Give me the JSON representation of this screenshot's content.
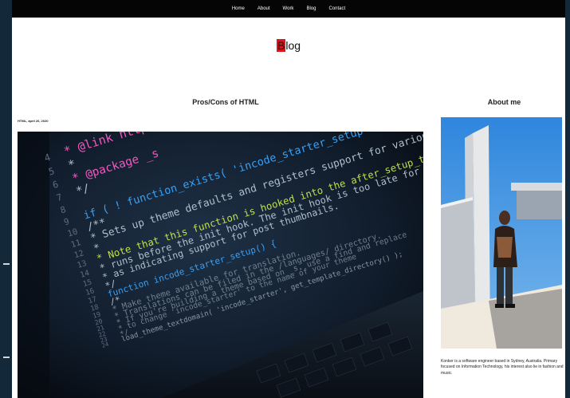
{
  "nav": {
    "items": [
      "Home",
      "About",
      "Work",
      "Blog",
      "Contact"
    ]
  },
  "logo": {
    "first_letter": "B",
    "rest": "log"
  },
  "post": {
    "title": "Pros/Cons of HTML",
    "meta": "HTML, april 26, 2020",
    "image_label": "code-on-laptop-screen-photo",
    "code_lines": [
      {
        "num": "4",
        "text": "* @link https://deve"
      },
      {
        "num": "5",
        "text": "*"
      },
      {
        "num": "6",
        "text": "* @package _s"
      },
      {
        "num": "7",
        "text": "*/"
      },
      {
        "num": "8",
        "text": ""
      },
      {
        "num": "9",
        "text": "if ( ! function_exists( 'incode_starter_setup' ) ) :"
      },
      {
        "num": "10",
        "text": "/**"
      },
      {
        "num": "11",
        "text": "* Sets up theme defaults and registers support for various WordPress features."
      },
      {
        "num": "12",
        "text": "*"
      },
      {
        "num": "13",
        "text": "* Note that this function is hooked into the after_setup_theme hook, which"
      },
      {
        "num": "14",
        "text": "* runs before the init hook. The init hook is too late for some features, such"
      },
      {
        "num": "15",
        "text": "* as indicating support for post thumbnails."
      },
      {
        "num": "16",
        "text": "*/"
      },
      {
        "num": "17",
        "text": "function incode_starter_setup() {"
      },
      {
        "num": "18",
        "text": "/*"
      },
      {
        "num": "19",
        "text": "* Make theme available for translation."
      },
      {
        "num": "20",
        "text": "* Translations can be filed in the /languages/ directory."
      },
      {
        "num": "21",
        "text": "* If you're building a theme based on _s, use a find and replace"
      },
      {
        "num": "22",
        "text": "* to change 'incode_starter' to the name of your theme"
      },
      {
        "num": "23",
        "text": "*/"
      },
      {
        "num": "24",
        "text": "load_theme_textdomain( 'incode_starter', get_template_directory() );"
      }
    ]
  },
  "about": {
    "title": "About me",
    "image_label": "portrait-photo",
    "text": "Konker is a software engineer based in Sydney, Australia. Primary focused on Information Technology, his interest also lie in fashion and music."
  },
  "colors": {
    "nav_bg": "#050505",
    "logo_accent": "#d8161d",
    "page_bg": "#ffffff",
    "frame_bg": "#13293a",
    "code_bg": "#0b1420",
    "sky_blue": "#4a8fd4"
  }
}
